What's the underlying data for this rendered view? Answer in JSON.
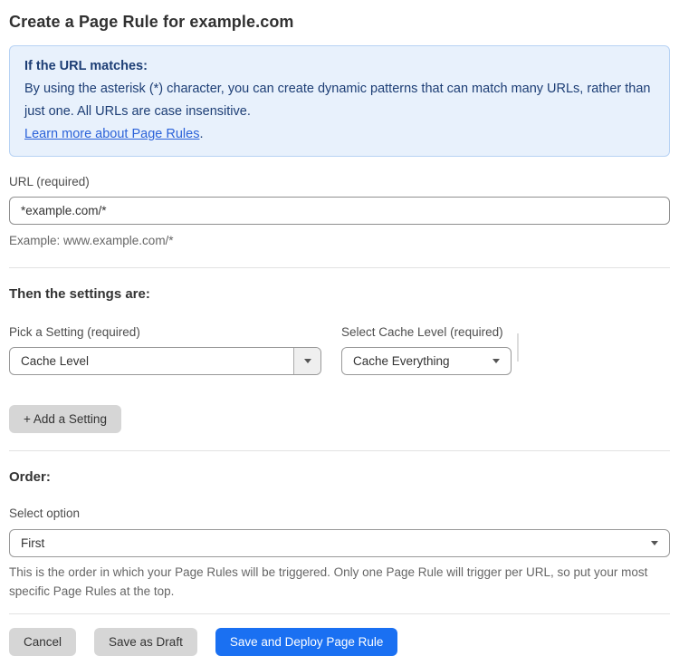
{
  "page": {
    "title": "Create a Page Rule for example.com"
  },
  "callout": {
    "heading": "If the URL matches:",
    "body": "By using the asterisk (*) character, you can create dynamic patterns that can match many URLs, rather than just one. All URLs are case insensitive.",
    "link": "Learn more about Page Rules",
    "link_suffix": "."
  },
  "url_field": {
    "label": "URL (required)",
    "value": "*example.com/*",
    "helper": "Example: www.example.com/*"
  },
  "settings": {
    "heading": "Then the settings are:",
    "setting_picker": {
      "label": "Pick a Setting (required)",
      "value": "Cache Level"
    },
    "cache_level_picker": {
      "label": "Select Cache Level (required)",
      "value": "Cache Everything"
    },
    "add_button_label": "+ Add a Setting"
  },
  "order": {
    "heading": "Order:",
    "label": "Select option",
    "value": "First",
    "helper": "This is the order in which your Page Rules will be triggered. Only one Page Rule will trigger per URL, so put your most specific Page Rules at the top."
  },
  "footer": {
    "cancel_label": "Cancel",
    "save_draft_label": "Save as Draft",
    "save_deploy_label": "Save and Deploy Page Rule"
  },
  "colors": {
    "primary_blue": "#1a70f2",
    "callout_bg": "#e8f1fc",
    "callout_border": "#b8d3f4",
    "callout_text": "#1d3e75",
    "link_blue": "#2b62d9",
    "button_gray": "#d6d6d6"
  },
  "icons": {
    "dropdown_arrow": "chevron-down"
  }
}
